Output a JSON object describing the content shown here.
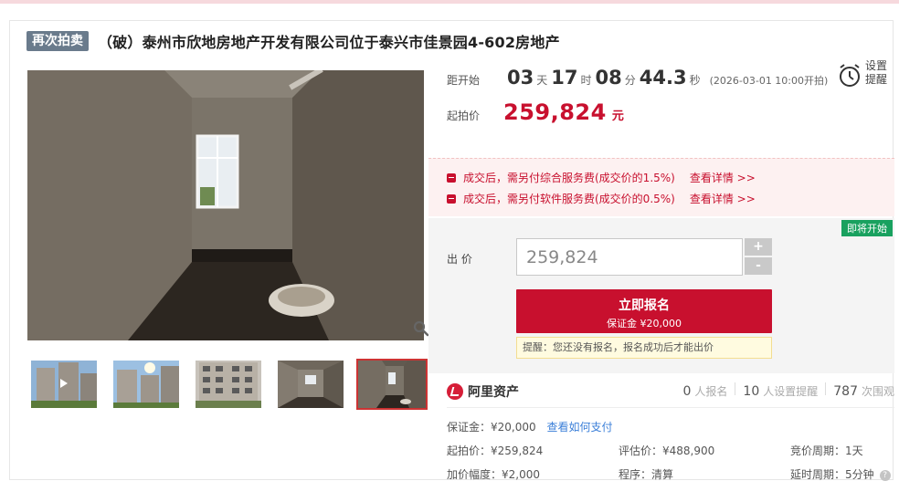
{
  "header": {
    "tag": "再次拍卖",
    "title": "（破）泰州市欣地房地产开发有限公司位于泰兴市佳景园4-602房地产"
  },
  "countdown": {
    "label": "距开始",
    "days": "03",
    "days_unit": "天",
    "hours": "17",
    "hours_unit": "时",
    "minutes": "08",
    "minutes_unit": "分",
    "seconds": "44.3",
    "seconds_unit": "秒",
    "start_note": "(2026-03-01 10:00开拍)"
  },
  "reminder": {
    "label_line1": "设置",
    "label_line2": "提醒"
  },
  "starting_price": {
    "label": "起拍价",
    "value": "259,824",
    "unit": "元"
  },
  "fees": [
    {
      "text": "成交后，需另付综合服务费(成交价的1.5%)",
      "link": "查看详情 >>"
    },
    {
      "text": "成交后，需另付软件服务费(成交价的0.5%)",
      "link": "查看详情 >>"
    }
  ],
  "bid": {
    "status_badge": "即将开始",
    "label": "出 价",
    "input_value": "259,824",
    "plus": "+",
    "minus": "-",
    "signup_label": "立即报名",
    "deposit_label": "保证金 ¥20,000",
    "tip": "提醒：您还没有报名，报名成功后才能出价"
  },
  "brand": {
    "name": "阿里资产"
  },
  "stats": [
    {
      "count": "0",
      "label": "人报名"
    },
    {
      "count": "10",
      "label": "人设置提醒"
    },
    {
      "count": "787",
      "label": "次围观"
    }
  ],
  "details": {
    "deposit": "保证金：¥20,000",
    "deposit_link": "查看如何支付",
    "start_price": "起拍价：¥259,824",
    "appraisal": "评估价：¥488,900",
    "cycle": "竞价周期：1天",
    "increment": "加价幅度：¥2,000",
    "procedure": "程序：清算",
    "extension": "延时周期：5分钟"
  },
  "gallery": {
    "thumbnails": [
      "building-video",
      "building-exterior",
      "building-facade",
      "interior-room",
      "interior-bathroom"
    ],
    "active_index": 4
  },
  "colors": {
    "accent": "#c8102e",
    "tag_bg": "#6a7b8c",
    "badge_green": "#19a15f",
    "link_blue": "#3b7fd8"
  }
}
